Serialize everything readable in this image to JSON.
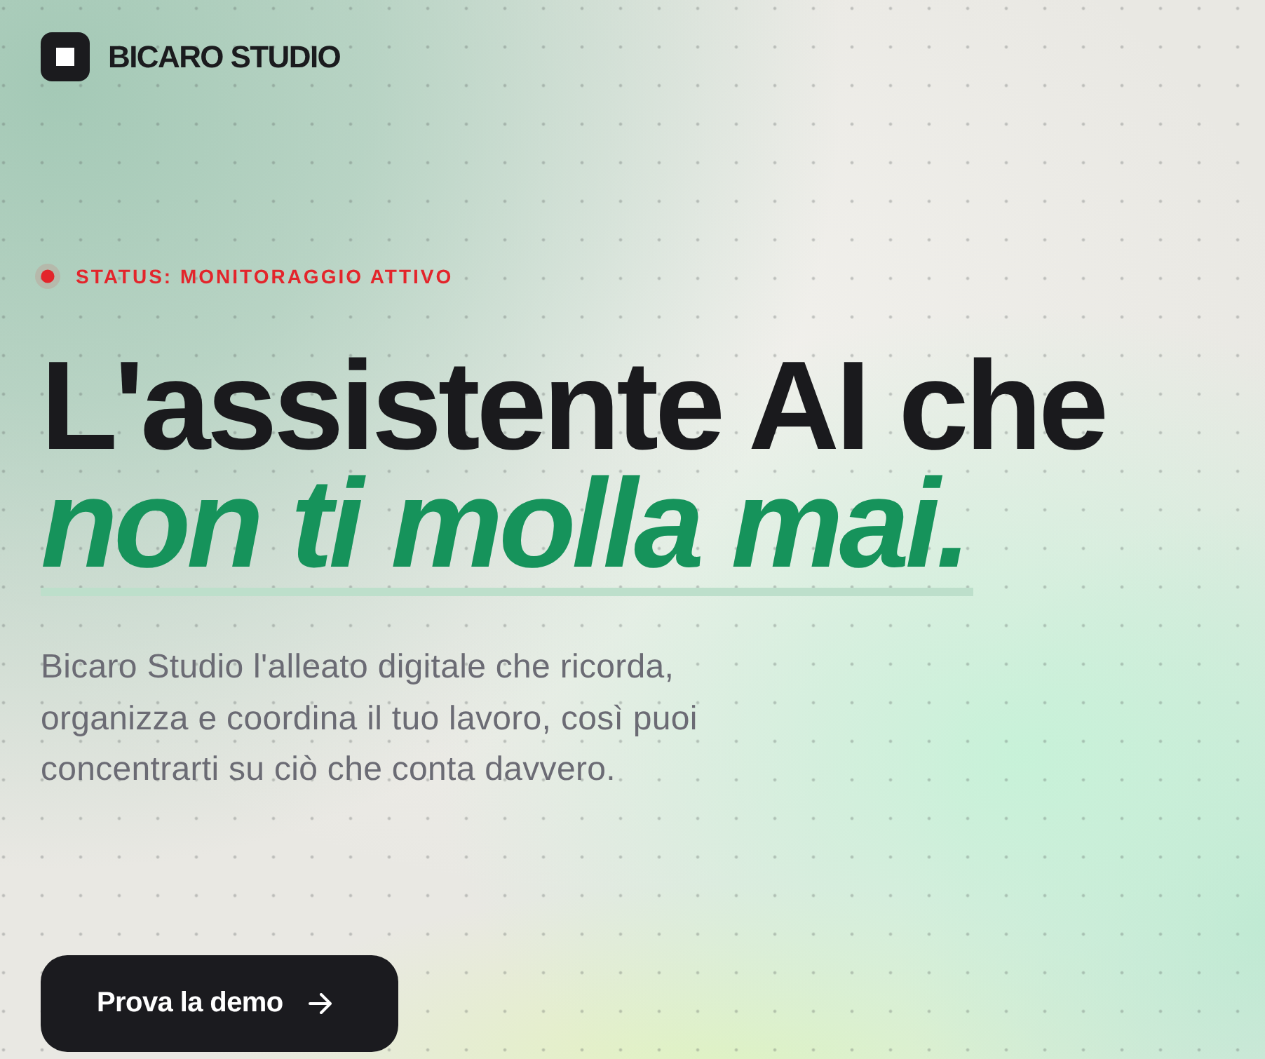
{
  "brand": {
    "name": "BICARO STUDIO"
  },
  "status": {
    "label": "STATUS: MONITORAGGIO ATTIVO"
  },
  "headline": {
    "text": "L'assistente AI che",
    "highlight": "non ti molla mai."
  },
  "description": "Bicaro Studio l'alleato digitale che ricorda, organizza e coordina il tuo lavoro, così puoi concentrarti su ciò che conta davvero.",
  "cta": {
    "label": "Prova la demo"
  }
}
